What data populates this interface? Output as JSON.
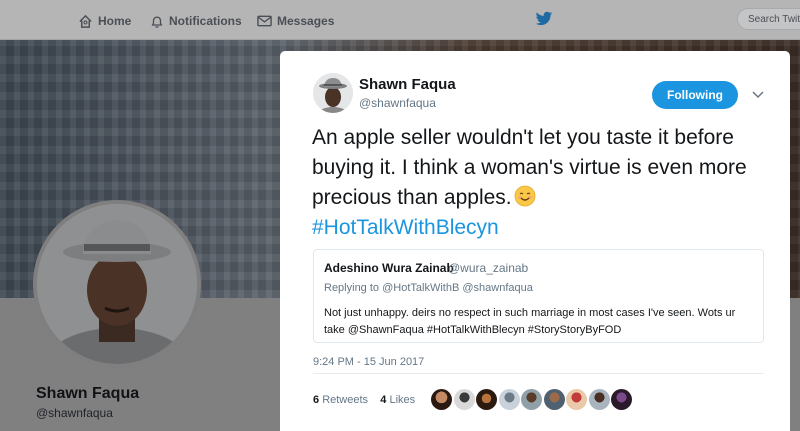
{
  "nav": {
    "home": "Home",
    "notifications": "Notifications",
    "messages": "Messages",
    "search_placeholder": "Search Twitt"
  },
  "profile": {
    "name": "Shawn Faqua",
    "handle": "@shawnfaqua"
  },
  "tweet": {
    "author_name": "Shawn Faqua",
    "author_handle": "@shawnfaqua",
    "follow_label": "Following",
    "text": "An apple seller wouldn't let you taste it before buying it. I think a woman's virtue is even more precious than apples.",
    "emoji": "smiling-face-emoji",
    "hashtag": "#HotTalkWithBlecyn",
    "timestamp": "9:24 PM - 15 Jun 2017",
    "retweets_count": "6",
    "retweets_label": "Retweets",
    "likes_count": "4",
    "likes_label": "Likes"
  },
  "quote": {
    "name": "Adeshino Wura Zainab",
    "handle": "@wura_zainab",
    "replying_prefix": "Replying to",
    "replying_to_1": "@HotTalkWithB",
    "replying_to_2": "@shawnfaqua",
    "text": "Not just unhappy. deirs no respect in such marriage in most cases I've seen. Wots ur take @ShawnFaqua #HotTalkWithBlecyn #StoryStoryByFOD"
  },
  "colors": {
    "accent": "#1b95e0",
    "text": "#14171a",
    "muted": "#657786"
  },
  "likers": [
    "liker-avatar-1",
    "liker-avatar-2",
    "liker-avatar-3",
    "liker-avatar-4",
    "liker-avatar-5",
    "liker-avatar-6",
    "liker-avatar-7",
    "liker-avatar-8",
    "liker-avatar-9"
  ]
}
